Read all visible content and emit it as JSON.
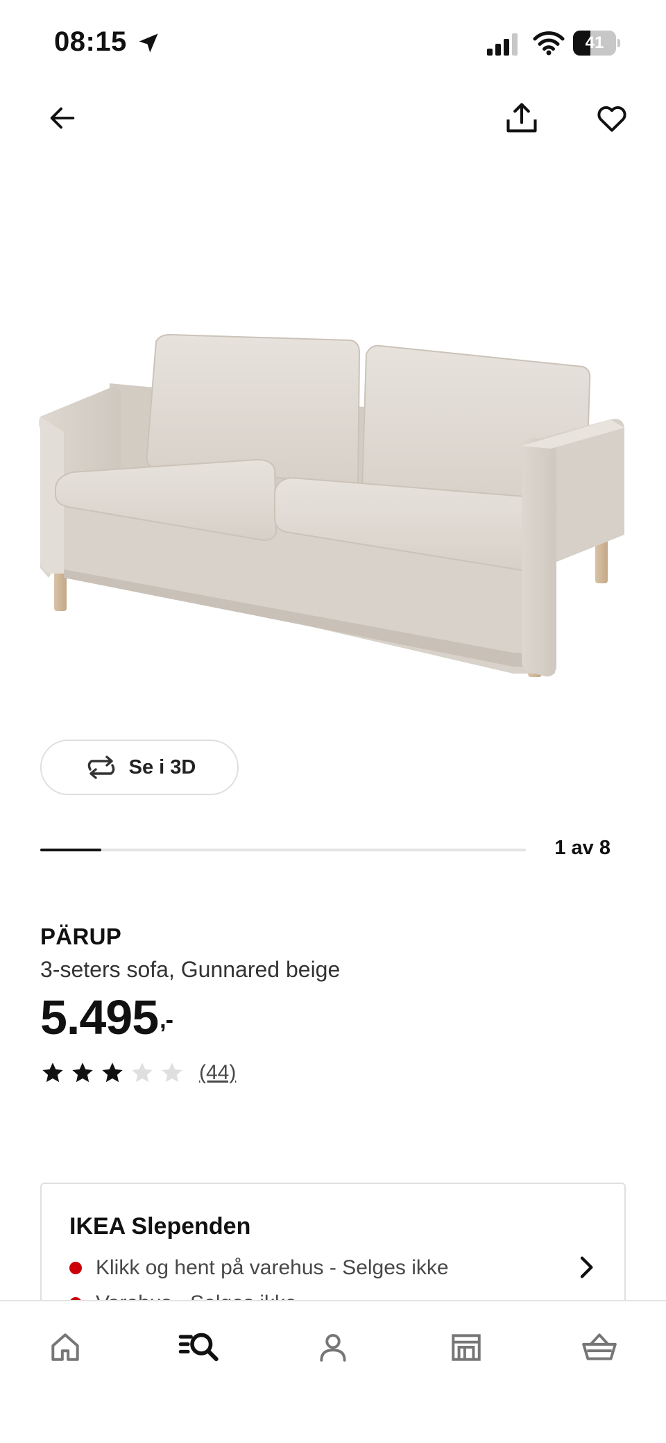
{
  "status_bar": {
    "time": "08:15",
    "battery_level": "41",
    "battery_fraction": 0.41
  },
  "top_nav": {
    "back_icon": "arrow-left-icon",
    "share_icon": "share-upload-icon",
    "favorite_icon": "heart-outline-icon"
  },
  "product_image": {
    "icon": "sofa-image"
  },
  "view_3d": {
    "label": "Se i 3D",
    "icon": "rotate-3d-icon"
  },
  "gallery": {
    "counter": "1 av 8",
    "current": 1,
    "total": 8
  },
  "product": {
    "name": "PÄRUP",
    "description": "3-seters sofa, Gunnared beige",
    "price": "5.495",
    "price_suffix": ",-",
    "rating": 3,
    "rating_max": 5,
    "review_count": "(44)"
  },
  "store": {
    "name": "IKEA Slependen",
    "rows": [
      {
        "text": "Klikk og hent på varehus - Selges ikke",
        "status_color": "#cc0008"
      },
      {
        "text": "Varehus - Selges ikke",
        "status_color": "#cc0008"
      }
    ],
    "chevron_icon": "chevron-right-icon"
  },
  "tab_bar": {
    "tabs": [
      {
        "icon": "home-icon",
        "active": false
      },
      {
        "icon": "search-list-icon",
        "active": true
      },
      {
        "icon": "profile-icon",
        "active": false
      },
      {
        "icon": "store-icon",
        "active": false
      },
      {
        "icon": "basket-icon",
        "active": false
      }
    ]
  },
  "colors": {
    "accent_dot": "#cc0008",
    "text": "#111111",
    "muted_text": "#484848",
    "inactive_icon": "#767676",
    "star_empty": "#dfdfdf"
  }
}
